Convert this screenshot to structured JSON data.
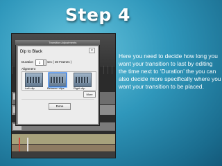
{
  "slide": {
    "title": "Step 4",
    "body_text": "Here you need to decide how long you want your transition to last by editing the time next to ‘Duration’ the you can also decide more specifically where you want your transition to be placed."
  },
  "editor": {
    "window_title": "Transition Adjustments",
    "dialog": {
      "title": "Dip to Black",
      "close_label": "x",
      "duration_label": "Duration",
      "duration_value": "1",
      "duration_unit": "sec  ( 30 Frames )",
      "alignment_label": "Alignment",
      "alignment_options": [
        "Left clip",
        "Between clips",
        "Right clip"
      ],
      "more_label": "More",
      "done_label": "Done"
    }
  },
  "colors": {
    "background": "#2f97bb",
    "title_text": "#ffffff",
    "body_text": "#ffffff",
    "selected_option": "#2d6fd0"
  }
}
